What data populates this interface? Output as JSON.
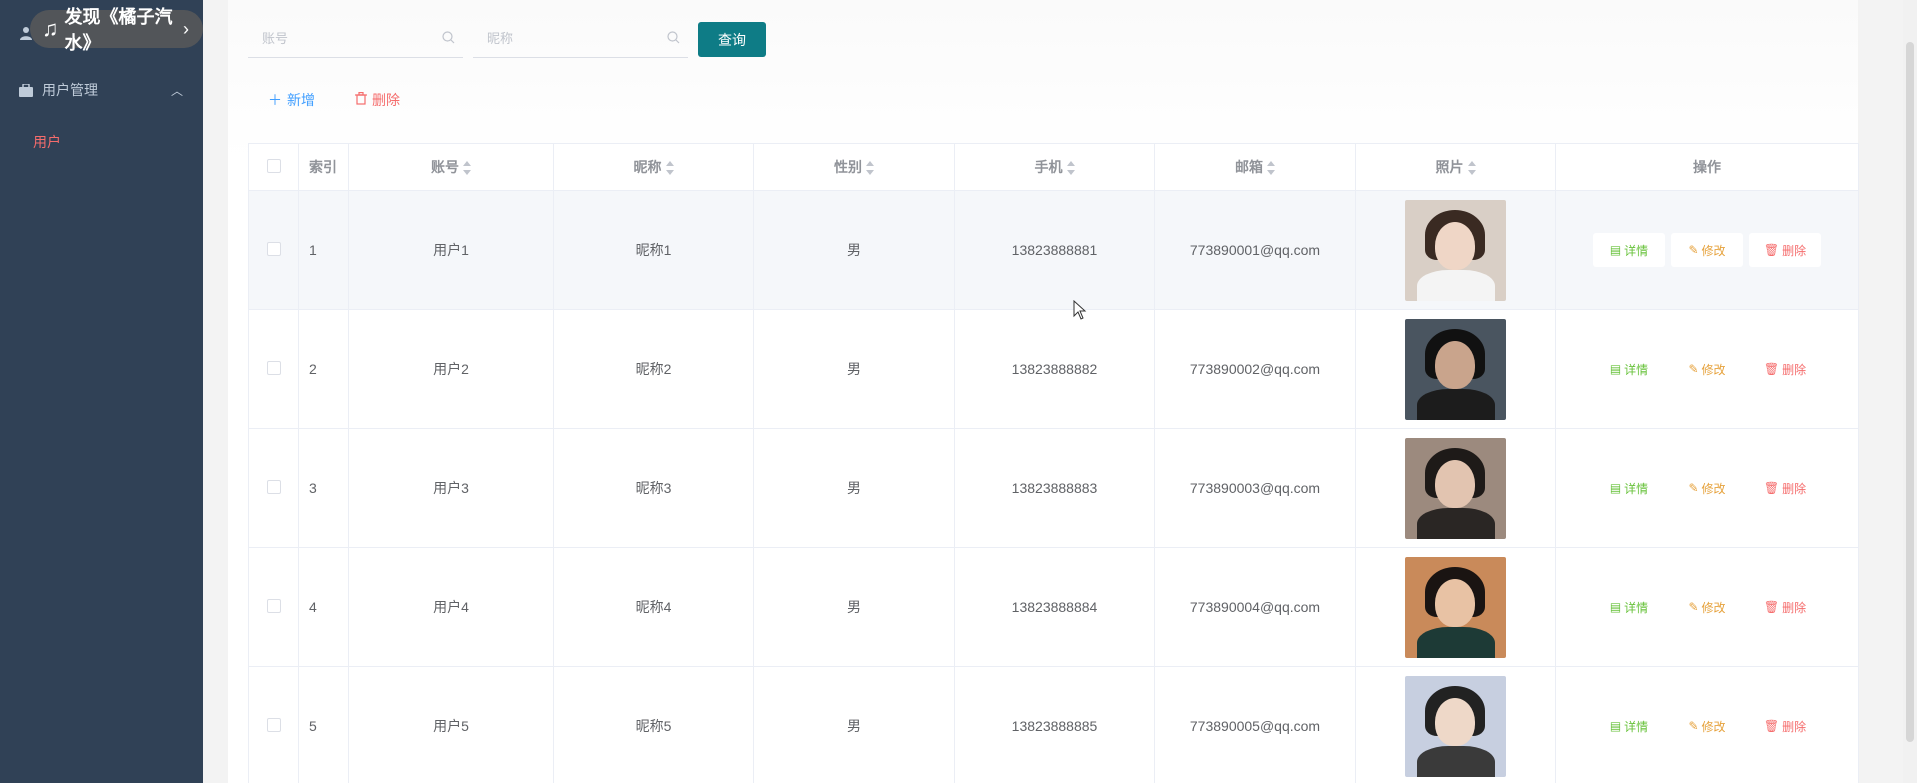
{
  "sidebar": {
    "user_label": "",
    "menu": [
      {
        "label": "用户管理",
        "icon": "briefcase-icon",
        "expanded": true
      },
      {
        "label": "用户",
        "active": true
      }
    ]
  },
  "overlay": {
    "music_text": "发现《橘子汽水》"
  },
  "search": {
    "account_placeholder": "账号",
    "nickname_placeholder": "昵称",
    "query_label": "查询"
  },
  "actions": {
    "add_label": "新增",
    "delete_label": "删除"
  },
  "table": {
    "columns": [
      "索引",
      "账号",
      "昵称",
      "性别",
      "手机",
      "邮箱",
      "照片",
      "操作"
    ],
    "rows": [
      {
        "index": "1",
        "account": "用户1",
        "nickname": "昵称1",
        "gender": "男",
        "phone": "13823888881",
        "email": "773890001@qq.com"
      },
      {
        "index": "2",
        "account": "用户2",
        "nickname": "昵称2",
        "gender": "男",
        "phone": "13823888882",
        "email": "773890002@qq.com"
      },
      {
        "index": "3",
        "account": "用户3",
        "nickname": "昵称3",
        "gender": "男",
        "phone": "13823888883",
        "email": "773890003@qq.com"
      },
      {
        "index": "4",
        "account": "用户4",
        "nickname": "昵称4",
        "gender": "男",
        "phone": "13823888884",
        "email": "773890004@qq.com"
      },
      {
        "index": "5",
        "account": "用户5",
        "nickname": "昵称5",
        "gender": "男",
        "phone": "13823888885",
        "email": "773890005@qq.com"
      }
    ],
    "op_labels": {
      "detail": "详情",
      "edit": "修改",
      "delete": "删除"
    }
  },
  "colors": {
    "sidebar_bg": "#304156",
    "active_menu": "#f56c6c",
    "query_button": "#0e7c86",
    "detail": "#67c23a",
    "edit": "#e6a23c",
    "delete": "#f56c6c",
    "add": "#409eff"
  }
}
